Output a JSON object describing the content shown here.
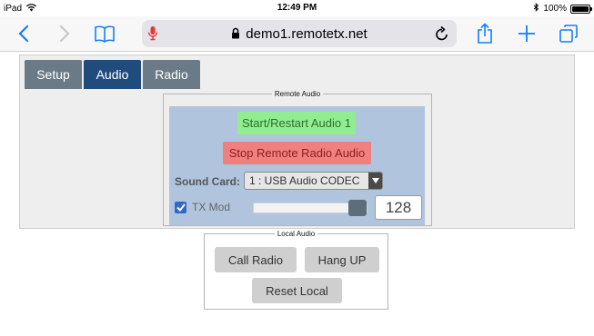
{
  "status_bar": {
    "device": "iPad",
    "time": "12:49 PM",
    "battery": "100%"
  },
  "browser": {
    "url": "demo1.remotetx.net"
  },
  "tabs": [
    {
      "label": "Setup",
      "active": false
    },
    {
      "label": "Audio",
      "active": true
    },
    {
      "label": "Radio",
      "active": false
    }
  ],
  "remote_audio": {
    "legend": "Remote Audio",
    "start_label": "Start/Restart Audio 1",
    "stop_label": "Stop Remote Radio Audio",
    "sound_card_label": "Sound Card:",
    "sound_card_value": "1 : USB Audio CODEC",
    "tx_mod_label": "TX Mod",
    "tx_mod_checked": true,
    "tx_mod_value": "128",
    "tx_mod_level_fraction": 1.0
  },
  "local_audio": {
    "legend": "Local Audio",
    "call_label": "Call Radio",
    "hangup_label": "Hang UP",
    "reset_label": "Reset Local"
  },
  "colors": {
    "active_tab": "#1f4b7d",
    "inactive_tab": "#6a7a87",
    "start_button": "#90ee90",
    "stop_button": "#f08080",
    "remote_bg": "#b0c4de",
    "ios_blue": "#157efb",
    "mic_red": "#e53935"
  },
  "icons": [
    "wifi-icon",
    "bluetooth-icon",
    "battery-icon",
    "back-icon",
    "forward-icon",
    "bookmarks-icon",
    "microphone-icon",
    "lock-icon",
    "reload-icon",
    "share-icon",
    "new-tab-icon",
    "tabs-icon",
    "checkbox-icon",
    "dropdown-arrow-icon"
  ]
}
